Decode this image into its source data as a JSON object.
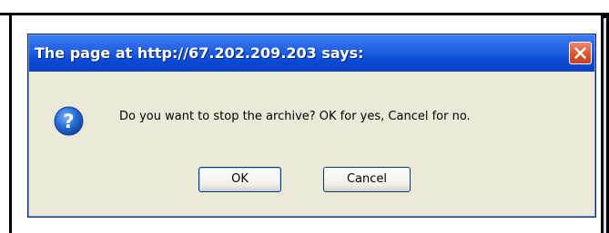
{
  "dialog": {
    "title": "The page at http://67.202.209.203 says:",
    "message": "Do you want to stop the archive? OK for yes, Cancel for no.",
    "ok_label": "OK",
    "cancel_label": "Cancel",
    "icon": "question-icon",
    "close_icon": "close-icon"
  },
  "colors": {
    "titlebar": "#0a42c4",
    "dialog_background": "#ece9d8",
    "close_button": "#d8502c",
    "icon_blue": "#2a6fd6"
  }
}
